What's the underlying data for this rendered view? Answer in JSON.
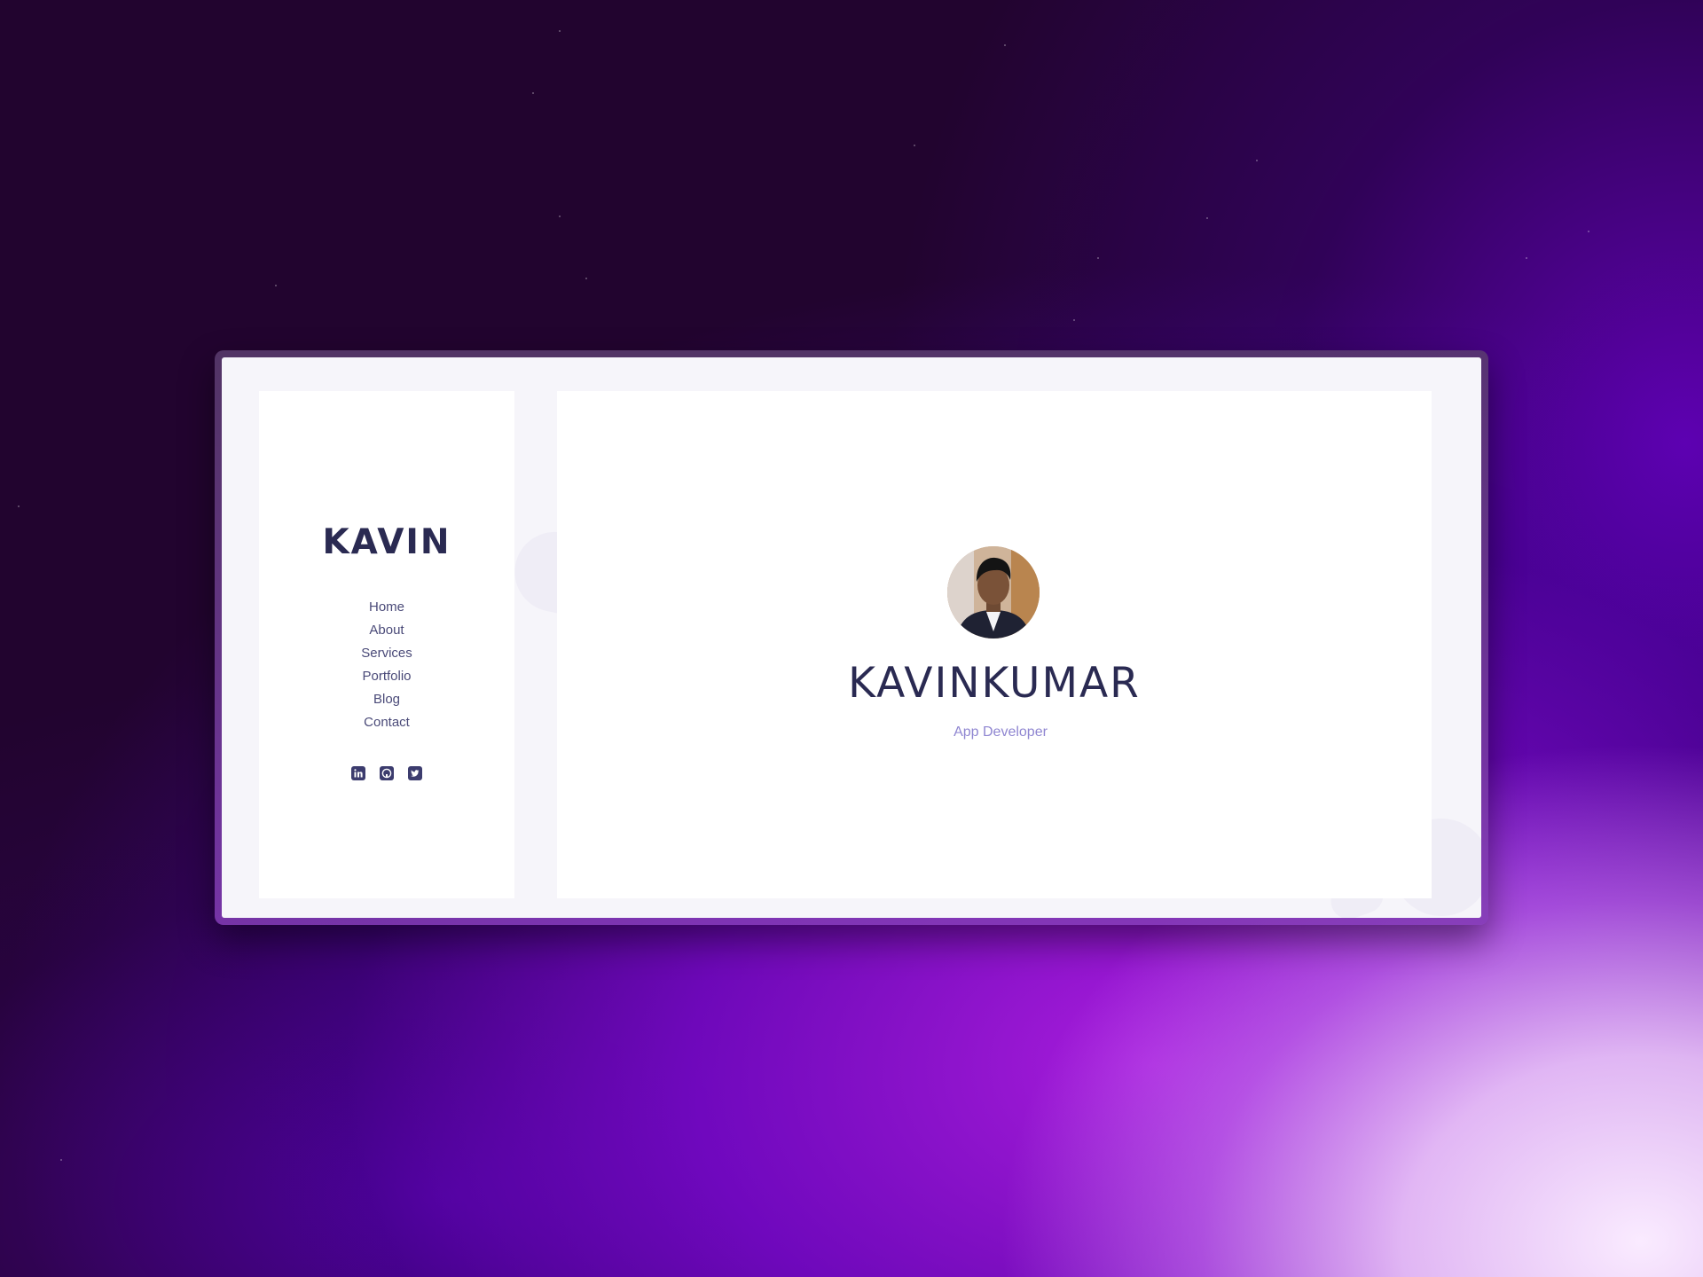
{
  "sidebar": {
    "logo": "KAVIN",
    "nav": [
      "Home",
      "About",
      "Services",
      "Portfolio",
      "Blog",
      "Contact"
    ],
    "socials": [
      "linkedin-icon",
      "github-icon",
      "twitter-icon"
    ]
  },
  "hero": {
    "name": "KAVINKUMAR",
    "role": "App Developer"
  },
  "colors": {
    "heading": "#2a2a52",
    "nav_text": "#4a4a78",
    "accent": "#8f86d1",
    "page_bg": "#f6f5fa"
  }
}
